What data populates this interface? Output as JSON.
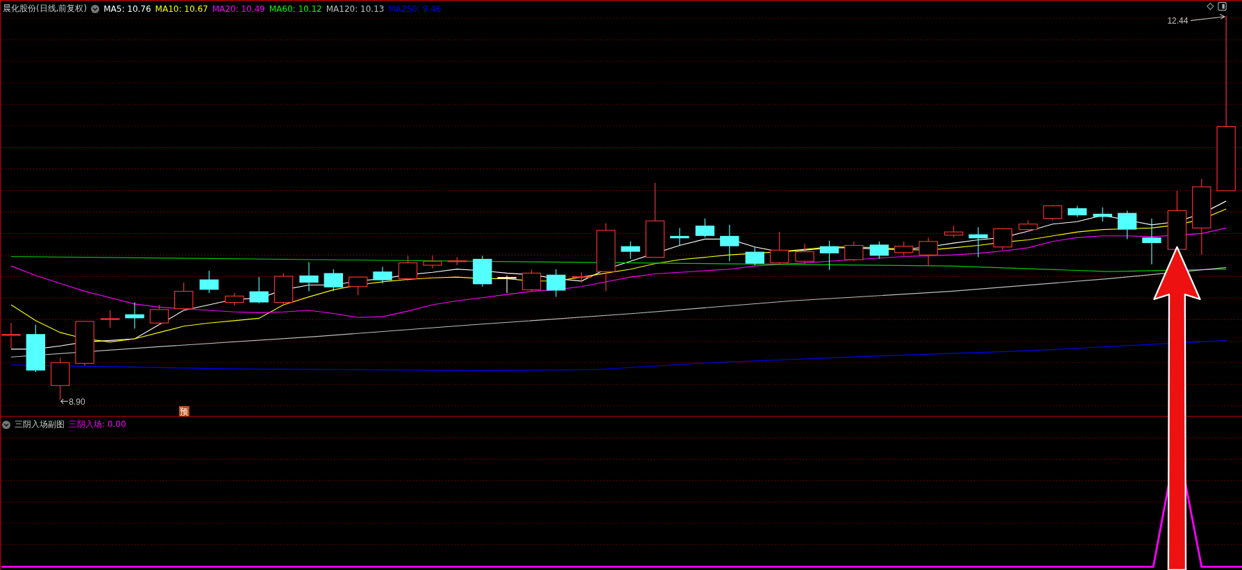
{
  "main_panel": {
    "title": "晨化股份(日线,前复权)",
    "indicators": [
      {
        "label": "MA5: 10.76",
        "color": "#ffffff"
      },
      {
        "label": "MA10: 10.67",
        "color": "#ffff00"
      },
      {
        "label": "MA20: 10.49",
        "color": "#ff00ff"
      },
      {
        "label": "MA60: 10.12",
        "color": "#00ff00"
      },
      {
        "label": "MA120: 10.13",
        "color": "#c0c0c0"
      },
      {
        "label": "MA250: 9.46",
        "color": "#0000ff"
      }
    ],
    "high_label": "12.44",
    "low_label": "8.90",
    "forecast_marker": "预"
  },
  "sub_panel": {
    "title": "三阴入场副图",
    "indicators": [
      {
        "label": "三阴入场: 0.00",
        "color": "#ff00ff"
      }
    ]
  }
}
